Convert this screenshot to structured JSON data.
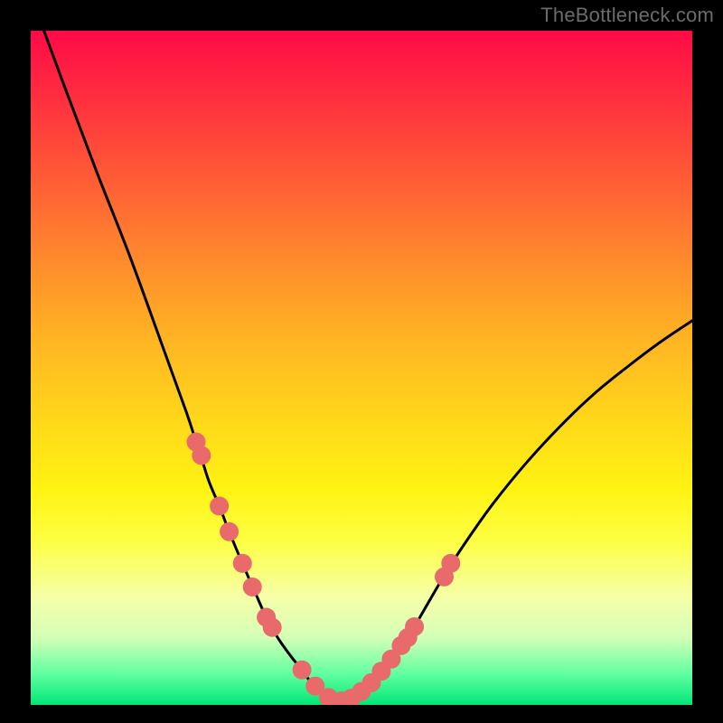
{
  "watermark": "TheBottleneck.com",
  "chart_data": {
    "type": "line",
    "title": "",
    "xlabel": "",
    "ylabel": "",
    "xlim": [
      0,
      100
    ],
    "ylim": [
      0,
      100
    ],
    "series": [
      {
        "name": "left-curve",
        "x": [
          2,
          5,
          10,
          15,
          20,
          23.5,
          25,
          26,
          27,
          28.5,
          30,
          32,
          34,
          35.6,
          37,
          38,
          39.5,
          41,
          42,
          43,
          44,
          45.5,
          46.5
        ],
        "values": [
          100,
          92,
          79,
          66.5,
          53,
          43.5,
          39,
          36,
          33,
          29.5,
          25.7,
          21,
          16.5,
          13,
          10.5,
          9,
          7,
          5.2,
          3.8,
          2.8,
          1.8,
          0.9,
          0.45
        ]
      },
      {
        "name": "right-curve",
        "x": [
          46.5,
          48,
          49.5,
          51,
          52.5,
          54,
          55.5,
          57,
          58,
          60,
          63,
          66,
          70,
          75,
          80,
          85,
          90,
          95,
          100
        ],
        "values": [
          0.45,
          0.8,
          1.6,
          2.7,
          4.2,
          6,
          7.8,
          10,
          11.6,
          15,
          20,
          24.5,
          30,
          36,
          41.3,
          46,
          50,
          53.7,
          57
        ]
      }
    ],
    "dots": {
      "name": "highlight-dots",
      "color": "#e86a6a",
      "radius": 10.5,
      "points": [
        {
          "x": 25.0,
          "y": 39.0
        },
        {
          "x": 25.8,
          "y": 37.0
        },
        {
          "x": 28.5,
          "y": 29.5
        },
        {
          "x": 30.0,
          "y": 25.7
        },
        {
          "x": 32.0,
          "y": 21.0
        },
        {
          "x": 33.5,
          "y": 17.5
        },
        {
          "x": 35.6,
          "y": 13.0
        },
        {
          "x": 36.5,
          "y": 11.5
        },
        {
          "x": 41.0,
          "y": 5.2
        },
        {
          "x": 43.0,
          "y": 2.8
        },
        {
          "x": 45.0,
          "y": 1.1
        },
        {
          "x": 47.0,
          "y": 0.6
        },
        {
          "x": 48.5,
          "y": 1.0
        },
        {
          "x": 50.0,
          "y": 2.0
        },
        {
          "x": 51.5,
          "y": 3.3
        },
        {
          "x": 53.0,
          "y": 5.0
        },
        {
          "x": 54.5,
          "y": 6.8
        },
        {
          "x": 56.0,
          "y": 8.8
        },
        {
          "x": 57.0,
          "y": 10.0
        },
        {
          "x": 58.0,
          "y": 11.6
        },
        {
          "x": 62.5,
          "y": 19.0
        },
        {
          "x": 63.5,
          "y": 21.0
        }
      ]
    }
  }
}
